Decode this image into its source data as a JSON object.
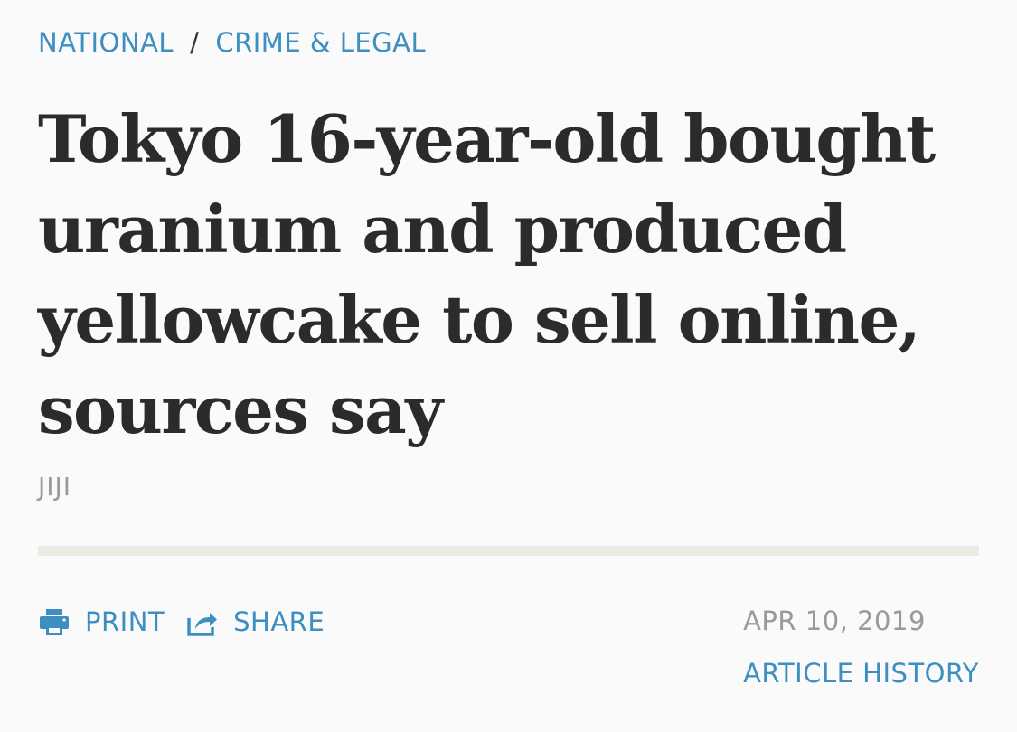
{
  "breadcrumb": {
    "section": "NATIONAL",
    "separator": "/",
    "subsection": "CRIME & LEGAL"
  },
  "article": {
    "headline": "Tokyo 16-year-old bought uranium and produced yellowcake to sell online, sources say",
    "byline": "JIJI",
    "date": "APR 10, 2019"
  },
  "actions": {
    "print_label": "PRINT",
    "share_label": "SHARE",
    "history_label": "ARTICLE HISTORY"
  },
  "icons": {
    "print": "printer-icon",
    "share": "share-arrow-icon"
  },
  "colors": {
    "link": "#3d8fc1",
    "headline": "#2b2b2b",
    "muted": "#9a9a9a",
    "divider": "#ebeae3",
    "background": "#fafafa"
  }
}
